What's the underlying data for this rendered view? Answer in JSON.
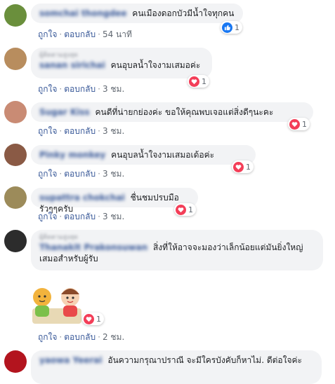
{
  "comments": [
    {
      "name": "somchai thongdee",
      "text": "คนเมืองดอกบัวมีน้ำใจทุกคน",
      "like": "ถูกใจ",
      "reply": "ตอบกลับ",
      "time": "54 นาที",
      "reaction": "like",
      "count": "1",
      "avatar_color": "#6a8f3c"
    },
    {
      "header": "ผู้ติดตามสูงสุด",
      "name": "sanan sirichai",
      "text": "คนอุบลน้ำใจงามเสมอค่ะ",
      "like": "ถูกใจ",
      "reply": "ตอบกลับ",
      "time": "3 ชม.",
      "reaction": "love",
      "count": "1",
      "avatar_color": "#b88d5e"
    },
    {
      "name": "Sugar Kiss",
      "text": "คนดีที่น่ายกย่องค่ะ ขอให้คุณพบเจอแต่สิ่งดีๆนะคะ",
      "like": "ถูกใจ",
      "reply": "ตอบกลับ",
      "time": "3 ชม.",
      "reaction": "love",
      "count": "1",
      "avatar_color": "#c98b74"
    },
    {
      "name": "Pinky monkey",
      "text": "คนอุบลน้ำใจงามเสมอเด้อค่ะ",
      "like": "ถูกใจ",
      "reply": "ตอบกลับ",
      "time": "3 ชม.",
      "reaction": "love",
      "count": "1",
      "avatar_color": "#8a5a45"
    },
    {
      "name": "supattra chokchai",
      "text": "ชื่นชมปรบมือรัวๆๆครับ",
      "like": "ถูกใจ",
      "reply": "ตอบกลับ",
      "time": "3 ชม.",
      "reaction": "love",
      "count": "1",
      "avatar_color": "#9c8b5a"
    },
    {
      "header": "ผู้ติดตามสูงสุด",
      "name": "Thanakit Prakonsuwan",
      "text": "สิ่งที่ให้อาจจะมองว่าเล็กน้อยแต่มันยิ่งใหญ่เสมอสำหรับผู้รับ",
      "like": "ถูกใจ",
      "reply": "ตอบกลับ",
      "time": "",
      "reaction": "",
      "count": "",
      "avatar_color": "#2c2c2c"
    },
    {
      "sticker": true,
      "like": "ถูกใจ",
      "reply": "ตอบกลับ",
      "time": "2 ชม.",
      "reaction": "love",
      "count": "1",
      "avatar_color": ""
    },
    {
      "name": "yaowa Yeerai",
      "text": "อันความกรุณาปราณี จะมีใครบังคับก็หาไม่. ดีต่อใจค่ะ",
      "like": "",
      "reply": "",
      "time": "",
      "reaction": "",
      "count": "",
      "avatar_color": "#b3141e"
    }
  ]
}
